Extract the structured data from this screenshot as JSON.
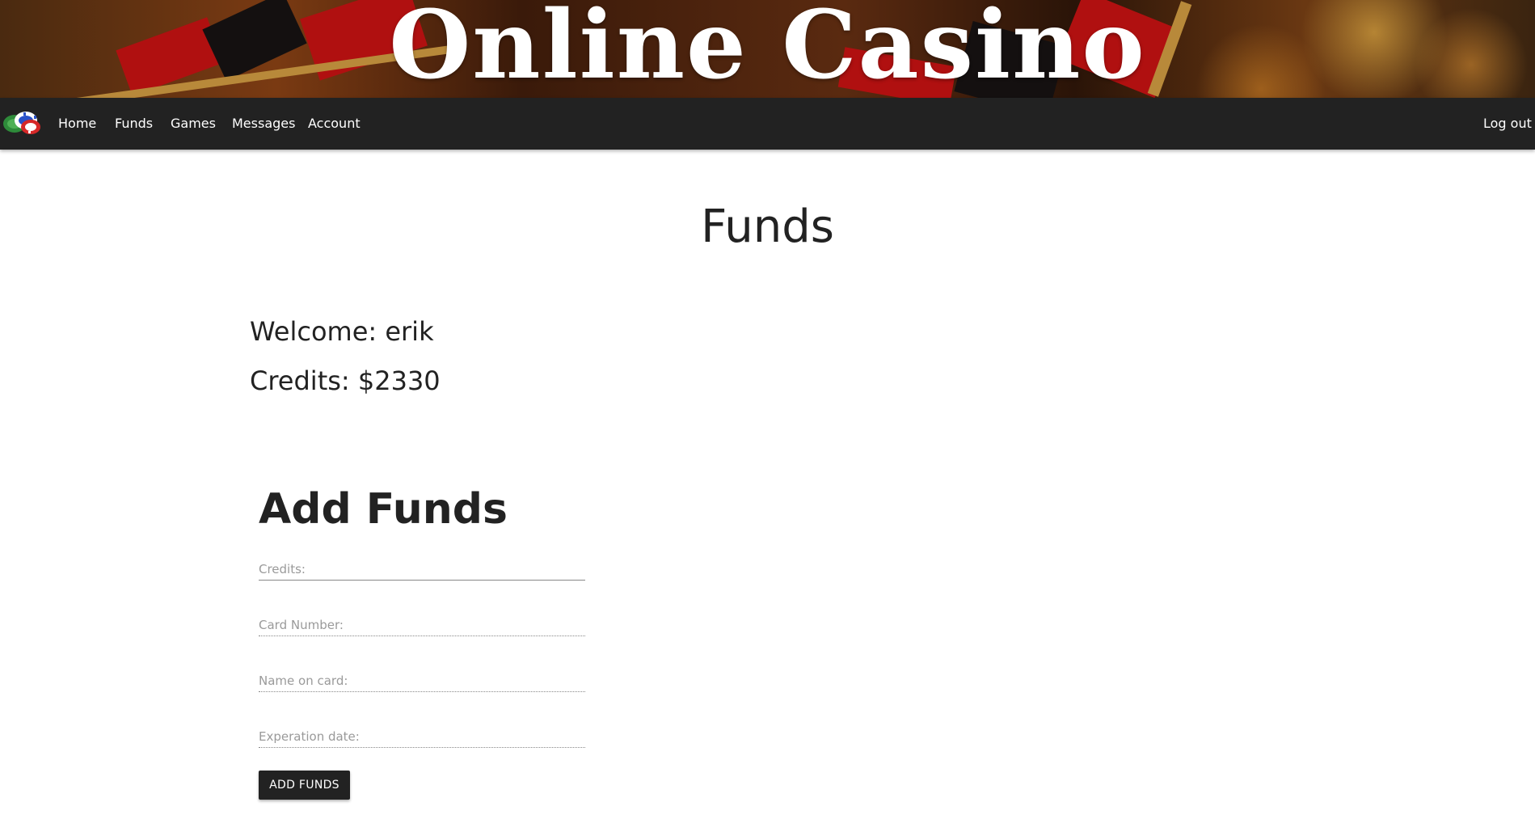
{
  "banner": {
    "title": "Online Casino"
  },
  "nav": {
    "logo_icon": "poker-chips-icon",
    "items": [
      {
        "label": "Home"
      },
      {
        "label": "Funds"
      },
      {
        "label": "Games"
      },
      {
        "label": "Messages"
      },
      {
        "label": "Account"
      }
    ],
    "logout": "Log out"
  },
  "page": {
    "title": "Funds",
    "welcome": "Welcome: erik",
    "credits": "Credits: $2330"
  },
  "form": {
    "title": "Add Funds",
    "fields": [
      {
        "placeholder": "Credits:",
        "value": ""
      },
      {
        "placeholder": "Card Number:",
        "value": ""
      },
      {
        "placeholder": "Name on card:",
        "value": ""
      },
      {
        "placeholder": "Experation date:",
        "value": ""
      }
    ],
    "submit": "ADD FUNDS"
  },
  "colors": {
    "navbar": "#222222",
    "button": "#222222",
    "text": "#222222"
  }
}
